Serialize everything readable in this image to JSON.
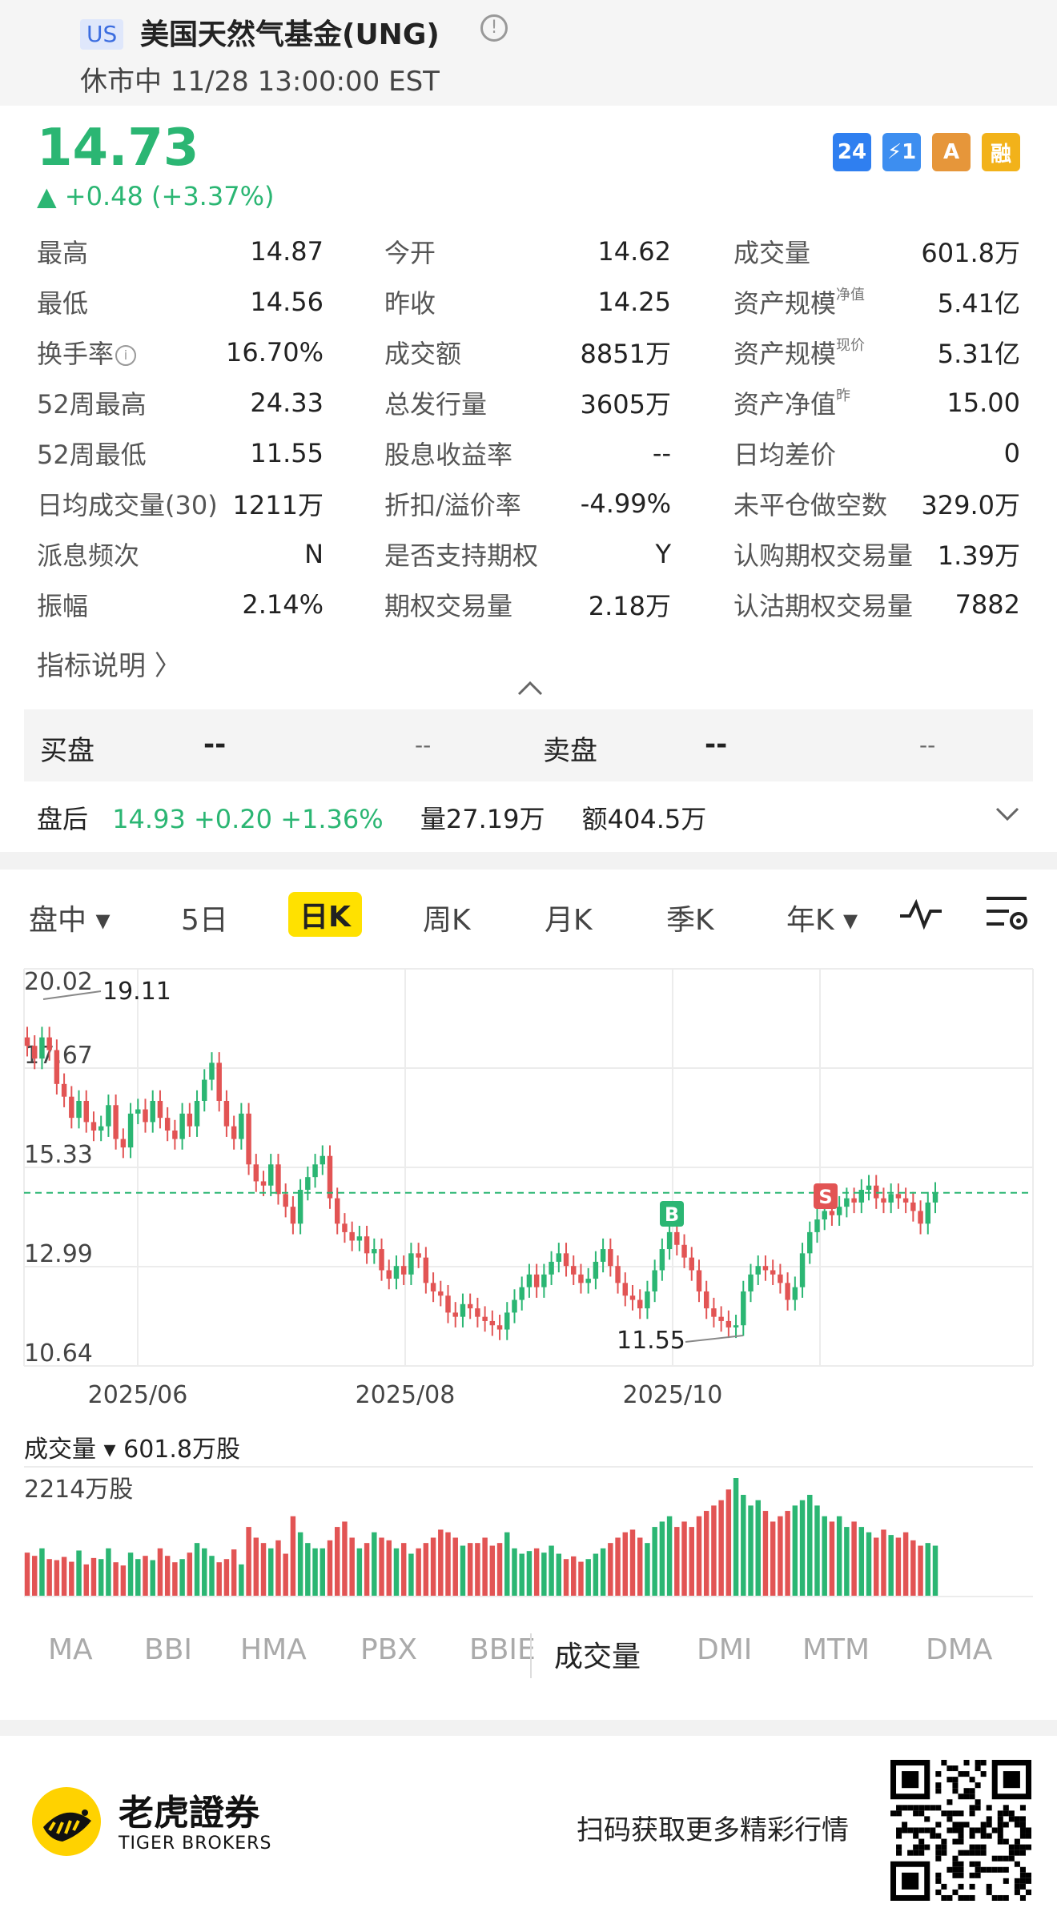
{
  "header": {
    "market_badge": "US",
    "stock_name": "美国天然气基金(UNG)",
    "status": "休市中 11/28 13:00:00 EST"
  },
  "quote": {
    "price": "14.73",
    "change": "▲ +0.48 (+3.37%)",
    "up_color": "#2bb673",
    "down_color": "#e25454",
    "badges": [
      {
        "label": "24",
        "color": "#2f7ff0"
      },
      {
        "label": "⚡1",
        "color": "#3d8ef0"
      },
      {
        "label": "A",
        "color": "#e6963a"
      },
      {
        "label": "融",
        "color": "#f2b21a"
      }
    ]
  },
  "stats": [
    [
      {
        "label": "最高",
        "value": "14.87"
      },
      {
        "label": "今开",
        "value": "14.62"
      },
      {
        "label": "成交量",
        "value": "601.8万"
      }
    ],
    [
      {
        "label": "最低",
        "value": "14.56"
      },
      {
        "label": "昨收",
        "value": "14.25"
      },
      {
        "label": "资产规模",
        "sup": "净值",
        "value": "5.41亿"
      }
    ],
    [
      {
        "label": "换手率",
        "info": true,
        "value": "16.70%"
      },
      {
        "label": "成交额",
        "value": "8851万"
      },
      {
        "label": "资产规模",
        "sup": "现价",
        "value": "5.31亿"
      }
    ],
    [
      {
        "label": "52周最高",
        "value": "24.33"
      },
      {
        "label": "总发行量",
        "value": "3605万"
      },
      {
        "label": "资产净值",
        "sup": "昨",
        "value": "15.00"
      }
    ],
    [
      {
        "label": "52周最低",
        "value": "11.55"
      },
      {
        "label": "股息收益率",
        "value": "--"
      },
      {
        "label": "日均差价",
        "value": "0"
      }
    ],
    [
      {
        "label": "日均成交量(30)",
        "value": "1211万"
      },
      {
        "label": "折扣/溢价率",
        "value": "-4.99%"
      },
      {
        "label": "未平仓做空数",
        "value": "329.0万"
      }
    ],
    [
      {
        "label": "派息频次",
        "value": "N"
      },
      {
        "label": "是否支持期权",
        "value": "Y"
      },
      {
        "label": "认购期权交易量",
        "value": "1.39万"
      }
    ],
    [
      {
        "label": "振幅",
        "value": "2.14%"
      },
      {
        "label": "期权交易量",
        "value": "2.18万"
      },
      {
        "label": "认沽期权交易量",
        "value": "7882"
      }
    ]
  ],
  "explain_link": "指标说明 〉",
  "collapse_icon": "chevron-up",
  "orderbook": {
    "bid_label": "买盘",
    "bid_price": "--",
    "bid_size": "--",
    "ask_label": "卖盘",
    "ask_price": "--",
    "ask_size": "--"
  },
  "after_hours": {
    "label": "盘后",
    "price_change": "14.93 +0.20 +1.36%",
    "volume": "量27.19万",
    "amount": "额404.5万"
  },
  "period_tabs": [
    "盘中 ▾",
    "5日",
    "日K",
    "周K",
    "月K",
    "季K",
    "年K ▾"
  ],
  "active_period": "日K",
  "chart_data": {
    "type": "candlestick",
    "y_ticks": [
      "20.02",
      "17.67",
      "15.33",
      "12.99",
      "10.64"
    ],
    "ylim": [
      10.64,
      20.02
    ],
    "x_ticks": [
      "2025/06",
      "2025/08",
      "2025/10"
    ],
    "annotations": {
      "high_label": "19.11",
      "low_label": "11.55",
      "buy_marker": "B",
      "sell_marker": "S"
    },
    "reference_line": 14.73,
    "closes": [
      18.2,
      17.9,
      18.4,
      18.1,
      17.3,
      17.0,
      16.5,
      16.9,
      16.4,
      16.2,
      16.3,
      16.8,
      16.0,
      15.8,
      16.6,
      16.7,
      16.4,
      16.9,
      16.5,
      16.2,
      16.0,
      16.6,
      16.3,
      16.9,
      17.4,
      17.8,
      16.9,
      16.3,
      16.0,
      16.6,
      15.4,
      15.0,
      14.9,
      15.4,
      14.7,
      14.4,
      14.0,
      14.8,
      15.1,
      15.4,
      15.6,
      14.6,
      14.0,
      13.8,
      13.6,
      13.7,
      13.3,
      13.4,
      12.9,
      12.7,
      13.0,
      12.8,
      13.3,
      13.2,
      12.6,
      12.4,
      12.3,
      11.9,
      11.8,
      12.1,
      12.0,
      11.8,
      11.7,
      11.6,
      11.5,
      11.9,
      12.2,
      12.5,
      12.8,
      12.5,
      12.8,
      13.1,
      13.3,
      13.0,
      12.8,
      12.6,
      12.7,
      13.1,
      13.4,
      13.0,
      12.6,
      12.3,
      12.2,
      12.0,
      12.4,
      12.9,
      13.4,
      13.8,
      13.5,
      13.2,
      12.9,
      12.4,
      12.0,
      11.8,
      11.7,
      11.55,
      11.6,
      12.4,
      12.8,
      13.0,
      12.9,
      12.8,
      12.6,
      12.2,
      12.5,
      13.3,
      13.8,
      14.1,
      14.3,
      14.2,
      14.4,
      14.6,
      14.5,
      14.8,
      14.9,
      14.6,
      14.5,
      14.7,
      14.6,
      14.5,
      14.3,
      14.0,
      14.5,
      14.73
    ],
    "volume_label": "成交量 ▾ 601.8万股",
    "volume_max_label": "2214万股",
    "volumes": [
      820,
      760,
      900,
      700,
      680,
      740,
      650,
      860,
      600,
      720,
      700,
      900,
      640,
      580,
      820,
      700,
      760,
      680,
      900,
      760,
      640,
      700,
      820,
      1000,
      900,
      760,
      640,
      700,
      880,
      600,
      1300,
      1100,
      1000,
      900,
      1050,
      800,
      1500,
      1200,
      1000,
      900,
      900,
      1050,
      1300,
      1400,
      1100,
      900,
      1000,
      1200,
      1100,
      1050,
      900,
      1000,
      800,
      900,
      1000,
      1100,
      1250,
      1200,
      1100,
      950,
      1000,
      1000,
      1100,
      950,
      1000,
      1200,
      900,
      800,
      850,
      900,
      820,
      950,
      800,
      700,
      750,
      650,
      700,
      800,
      900,
      1000,
      1100,
      1200,
      1250,
      1100,
      1000,
      1300,
      1400,
      1500,
      1300,
      1400,
      1300,
      1500,
      1600,
      1700,
      1800,
      2000,
      2214,
      1900,
      1700,
      1800,
      1600,
      1400,
      1500,
      1600,
      1700,
      1800,
      1900,
      1700,
      1500,
      1400,
      1500,
      1300,
      1400,
      1300,
      1200,
      1100,
      1250,
      1150,
      1100,
      1200,
      1050,
      950,
      1000,
      950
    ]
  },
  "indicators": [
    "MA",
    "BBI",
    "HMA",
    "PBX",
    "BBIE",
    "成交量",
    "DMI",
    "MTM",
    "DMA"
  ],
  "active_indicator": "成交量",
  "footer": {
    "brand_cn": "老虎證券",
    "brand_en": "TIGER BROKERS",
    "scan_text": "扫码获取更多精彩行情",
    "qr_icon": "qr-code-icon",
    "brand_color": "#ffd200"
  }
}
